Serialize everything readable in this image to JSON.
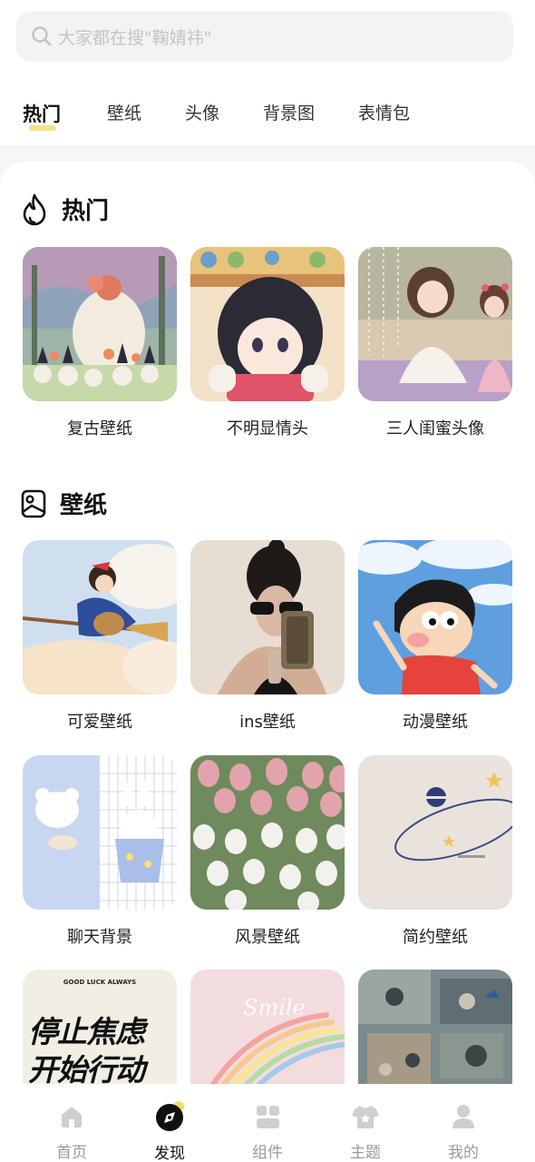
{
  "search": {
    "placeholder": "大家都在搜\"鞠婧祎\""
  },
  "tabs": [
    {
      "label": "热门",
      "active": true
    },
    {
      "label": "壁纸"
    },
    {
      "label": "头像"
    },
    {
      "label": "背景图"
    },
    {
      "label": "表情包"
    }
  ],
  "sections": {
    "hot": {
      "title": "热门",
      "icon": "flame-icon",
      "items": [
        {
          "label": "复古壁纸"
        },
        {
          "label": "不明显情头"
        },
        {
          "label": "三人闺蜜头像"
        }
      ]
    },
    "wallpaper": {
      "title": "壁纸",
      "icon": "image-icon",
      "items": [
        {
          "label": "可爱壁纸"
        },
        {
          "label": "ins壁纸"
        },
        {
          "label": "动漫壁纸"
        },
        {
          "label": "聊天背景"
        },
        {
          "label": "风景壁纸"
        },
        {
          "label": "简约壁纸"
        }
      ],
      "partial_row": {
        "poster_small": "GOOD LUCK ALWAYS",
        "poster_line1": "停止焦虑",
        "poster_line2": "开始行动",
        "smile_text": "Smile"
      }
    }
  },
  "bottom_nav": [
    {
      "label": "首页",
      "icon": "home-icon"
    },
    {
      "label": "发现",
      "icon": "discover-icon",
      "active": true
    },
    {
      "label": "组件",
      "icon": "widgets-icon"
    },
    {
      "label": "主题",
      "icon": "theme-shirt-icon"
    },
    {
      "label": "我的",
      "icon": "profile-icon"
    }
  ],
  "colors": {
    "accent": "#f5d86b",
    "active_text": "#111111",
    "inactive_text": "#9a9a9a"
  }
}
